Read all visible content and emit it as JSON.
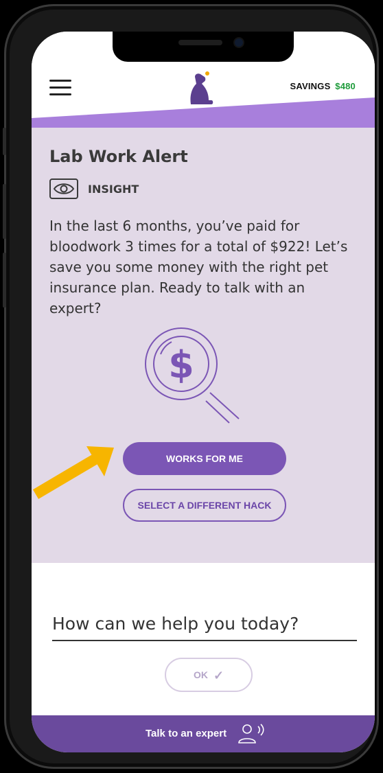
{
  "header": {
    "menu_icon": "hamburger-menu-icon",
    "logo_icon": "dog-logo-icon",
    "savings_label": "SAVINGS",
    "savings_amount": "$480"
  },
  "alert": {
    "title": "Lab Work Alert",
    "badge_icon": "eye-icon",
    "badge_label": "INSIGHT",
    "message": "In the last 6 months, you’ve paid for bloodwork 3 times for a total of $922! Let’s save you some money with the right pet insurance plan. Ready to talk with an expert?",
    "illustration_icon": "dollar-magnifier-icon"
  },
  "actions": {
    "primary_label": "WORKS FOR ME",
    "secondary_label": "SELECT A DIFFERENT HACK"
  },
  "help": {
    "placeholder": "How can we help you today?",
    "ok_label": "OK",
    "ok_icon": "checkmark-icon"
  },
  "footer": {
    "label": "Talk to an expert",
    "icon": "expert-voice-icon"
  },
  "colors": {
    "accent": "#7b56b5",
    "card_bg": "#e2d9e7",
    "footer_bg": "#6a4a9d",
    "savings_green": "#1d9b3a",
    "pointer_arrow": "#f7b500"
  }
}
